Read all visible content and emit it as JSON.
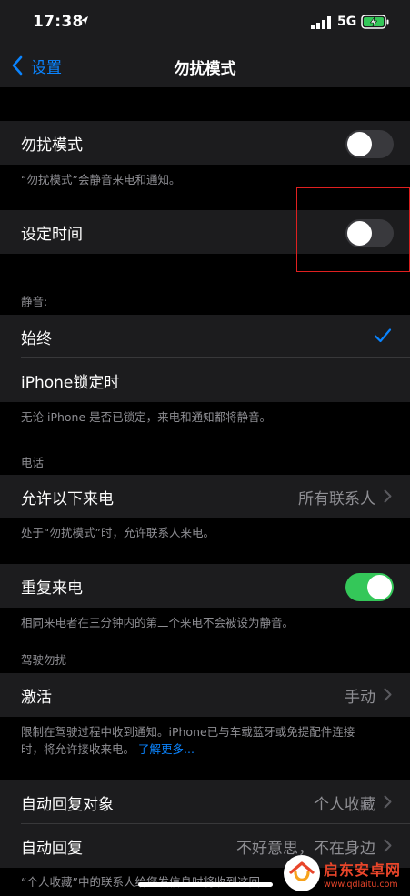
{
  "status_bar": {
    "time": "17:38",
    "network": "5G"
  },
  "nav": {
    "back_label": "设置",
    "title": "勿扰模式"
  },
  "dnd": {
    "label": "勿扰模式",
    "enabled": false,
    "note": "“勿扰模式”会静音来电和通知。"
  },
  "scheduled": {
    "label": "设定时间",
    "enabled": false
  },
  "silence": {
    "header": "静音:",
    "options": [
      {
        "label": "始终",
        "selected": true
      },
      {
        "label": "iPhone锁定时",
        "selected": false
      }
    ],
    "note": "无论 iPhone 是否已锁定，来电和通知都将静音。"
  },
  "phone": {
    "header": "电话",
    "allow_calls_label": "允许以下来电",
    "allow_calls_value": "所有联系人",
    "allow_calls_note": "处于“勿扰模式”时，允许联系人来电。",
    "repeated_calls_label": "重复来电",
    "repeated_calls_enabled": true,
    "repeated_calls_note": "相同来电者在三分钟内的第二个来电不会被设为静音。"
  },
  "driving": {
    "header": "驾驶勿扰",
    "activate_label": "激活",
    "activate_value": "手动",
    "note_line1": "限制在驾驶过程中收到通知。iPhone已与车载蓝牙或免提配件连接",
    "note_line2": "时，将允许接收来电。",
    "learn_more": "了解更多..."
  },
  "auto_reply": {
    "to_label": "自动回复对象",
    "to_value": "个人收藏",
    "reply_label": "自动回复",
    "reply_value": "不好意思，不在身边"
  },
  "bottom_note": "“个人收藏”中的联系人给您发信息时将收到这回",
  "watermark": {
    "name": "启东安卓网",
    "url": "www.qdlaitu.com"
  },
  "colors": {
    "accent": "#0a84ff",
    "toggle_on": "#34c759",
    "highlight": "#e02020"
  }
}
